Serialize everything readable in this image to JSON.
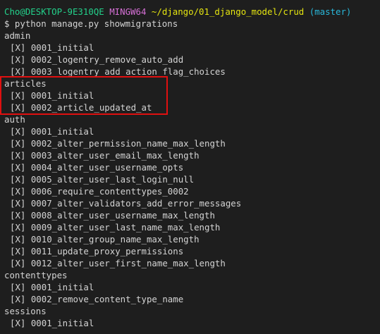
{
  "prompt": {
    "user_host": "Cho@DESKTOP-9E310QE",
    "shell": "MINGW64",
    "path": "~/django/01_django_model/crud",
    "branch": "(master)",
    "command": "$ python manage.py showmigrations"
  },
  "output": [
    {
      "type": "app",
      "text": "admin"
    },
    {
      "type": "migration",
      "text": "[X] 0001_initial"
    },
    {
      "type": "migration",
      "text": "[X] 0002_logentry_remove_auto_add"
    },
    {
      "type": "migration",
      "text": "[X] 0003_logentry_add_action_flag_choices"
    },
    {
      "type": "app",
      "text": "articles"
    },
    {
      "type": "migration",
      "text": "[X] 0001_initial"
    },
    {
      "type": "migration",
      "text": "[X] 0002_article_updated_at"
    },
    {
      "type": "app",
      "text": "auth"
    },
    {
      "type": "migration",
      "text": "[X] 0001_initial"
    },
    {
      "type": "migration",
      "text": "[X] 0002_alter_permission_name_max_length"
    },
    {
      "type": "migration",
      "text": "[X] 0003_alter_user_email_max_length"
    },
    {
      "type": "migration",
      "text": "[X] 0004_alter_user_username_opts"
    },
    {
      "type": "migration",
      "text": "[X] 0005_alter_user_last_login_null"
    },
    {
      "type": "migration",
      "text": "[X] 0006_require_contenttypes_0002"
    },
    {
      "type": "migration",
      "text": "[X] 0007_alter_validators_add_error_messages"
    },
    {
      "type": "migration",
      "text": "[X] 0008_alter_user_username_max_length"
    },
    {
      "type": "migration",
      "text": "[X] 0009_alter_user_last_name_max_length"
    },
    {
      "type": "migration",
      "text": "[X] 0010_alter_group_name_max_length"
    },
    {
      "type": "migration",
      "text": "[X] 0011_update_proxy_permissions"
    },
    {
      "type": "migration",
      "text": "[X] 0012_alter_user_first_name_max_length"
    },
    {
      "type": "app",
      "text": "contenttypes"
    },
    {
      "type": "migration",
      "text": "[X] 0001_initial"
    },
    {
      "type": "migration",
      "text": "[X] 0002_remove_content_type_name"
    },
    {
      "type": "app",
      "text": "sessions"
    },
    {
      "type": "migration",
      "text": "[X] 0001_initial"
    }
  ],
  "colors": {
    "background": "#1e1e1e",
    "text": "#d4d4d4",
    "user_host": "#23d18b",
    "shell": "#d670d6",
    "path": "#e5e510",
    "branch": "#29b8db",
    "highlight": "#e01010"
  }
}
